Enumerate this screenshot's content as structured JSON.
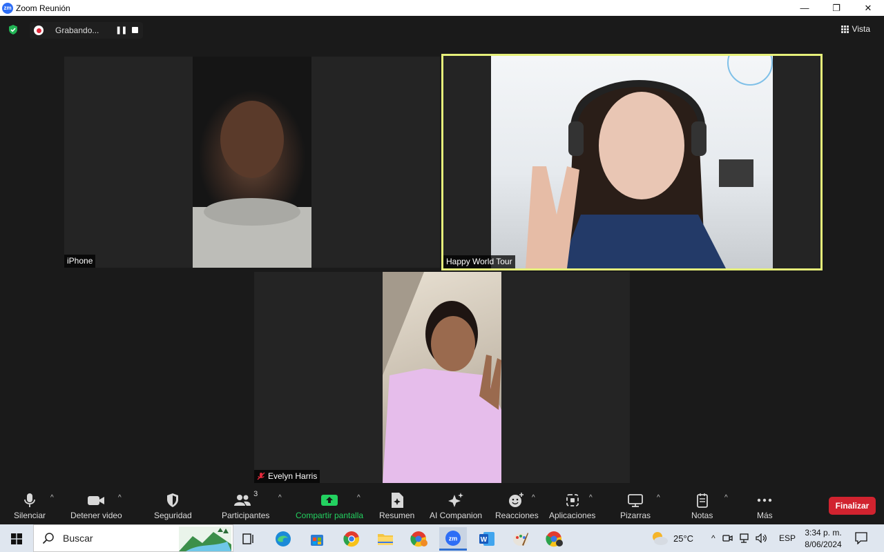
{
  "window": {
    "title": "Zoom Reunión"
  },
  "recording": {
    "label": "Grabando..."
  },
  "view": {
    "label": "Vista"
  },
  "participants": [
    {
      "name": "iPhone"
    },
    {
      "name": "Happy World Tour"
    },
    {
      "name": "Evelyn Harris",
      "muted": true
    }
  ],
  "toolbar": {
    "mute": "Silenciar",
    "video": "Detener video",
    "security": "Seguridad",
    "participants": "Participantes",
    "participants_count": "3",
    "share": "Compartir pantalla",
    "summary": "Resumen",
    "ai": "AI Companion",
    "reactions": "Reacciones",
    "apps": "Aplicaciones",
    "whiteboards": "Pizarras",
    "notes": "Notas",
    "more": "Más",
    "end": "Finalizar"
  },
  "taskbar": {
    "search_placeholder": "Buscar",
    "temperature": "25°C",
    "language": "ESP",
    "time": "3:34 p. m.",
    "date": "8/06/2024"
  },
  "colors": {
    "active_speaker": "#e6f07a",
    "share_green": "#23d160",
    "end_red": "#d1232f",
    "record_red": "#e0283a"
  }
}
